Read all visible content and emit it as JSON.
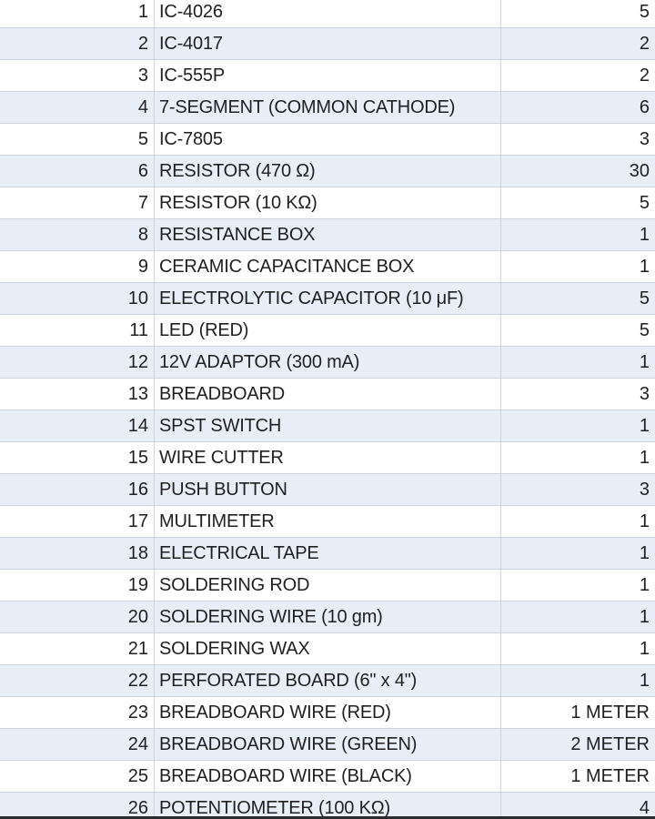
{
  "table": {
    "rows": [
      {
        "num": "1",
        "item": "IC-4026",
        "qty": "5"
      },
      {
        "num": "2",
        "item": "IC-4017",
        "qty": "2"
      },
      {
        "num": "3",
        "item": "IC-555P",
        "qty": "2"
      },
      {
        "num": "4",
        "item": "7-SEGMENT (COMMON CATHODE)",
        "qty": "6"
      },
      {
        "num": "5",
        "item": "IC-7805",
        "qty": "3"
      },
      {
        "num": "6",
        "item": "RESISTOR (470 Ω)",
        "qty": "30"
      },
      {
        "num": "7",
        "item": "RESISTOR (10 KΩ)",
        "qty": "5"
      },
      {
        "num": "8",
        "item": "RESISTANCE BOX",
        "qty": "1"
      },
      {
        "num": "9",
        "item": "CERAMIC CAPACITANCE BOX",
        "qty": "1"
      },
      {
        "num": "10",
        "item": "ELECTROLYTIC CAPACITOR (10 μF)",
        "qty": "5"
      },
      {
        "num": "11",
        "item": "LED (RED)",
        "qty": "5"
      },
      {
        "num": "12",
        "item": "12V ADAPTOR (300 mA)",
        "qty": "1"
      },
      {
        "num": "13",
        "item": "BREADBOARD",
        "qty": "3"
      },
      {
        "num": "14",
        "item": "SPST SWITCH",
        "qty": "1"
      },
      {
        "num": "15",
        "item": "WIRE CUTTER",
        "qty": "1"
      },
      {
        "num": "16",
        "item": "PUSH BUTTON",
        "qty": "3"
      },
      {
        "num": "17",
        "item": "MULTIMETER",
        "qty": "1"
      },
      {
        "num": "18",
        "item": "ELECTRICAL TAPE",
        "qty": "1"
      },
      {
        "num": "19",
        "item": "SOLDERING ROD",
        "qty": "1"
      },
      {
        "num": "20",
        "item": "SOLDERING WIRE (10 gm)",
        "qty": "1"
      },
      {
        "num": "21",
        "item": "SOLDERING WAX",
        "qty": "1"
      },
      {
        "num": "22",
        "item": "PERFORATED BOARD (6\" x 4\")",
        "qty": "1"
      },
      {
        "num": "23",
        "item": "BREADBOARD WIRE (RED)",
        "qty": "1 METER"
      },
      {
        "num": "24",
        "item": "BREADBOARD WIRE (GREEN)",
        "qty": "2 METER"
      },
      {
        "num": "25",
        "item": "BREADBOARD WIRE (BLACK)",
        "qty": "1 METER"
      },
      {
        "num": "26",
        "item": "POTENTIOMETER (100 KΩ)",
        "qty": "4"
      }
    ]
  }
}
